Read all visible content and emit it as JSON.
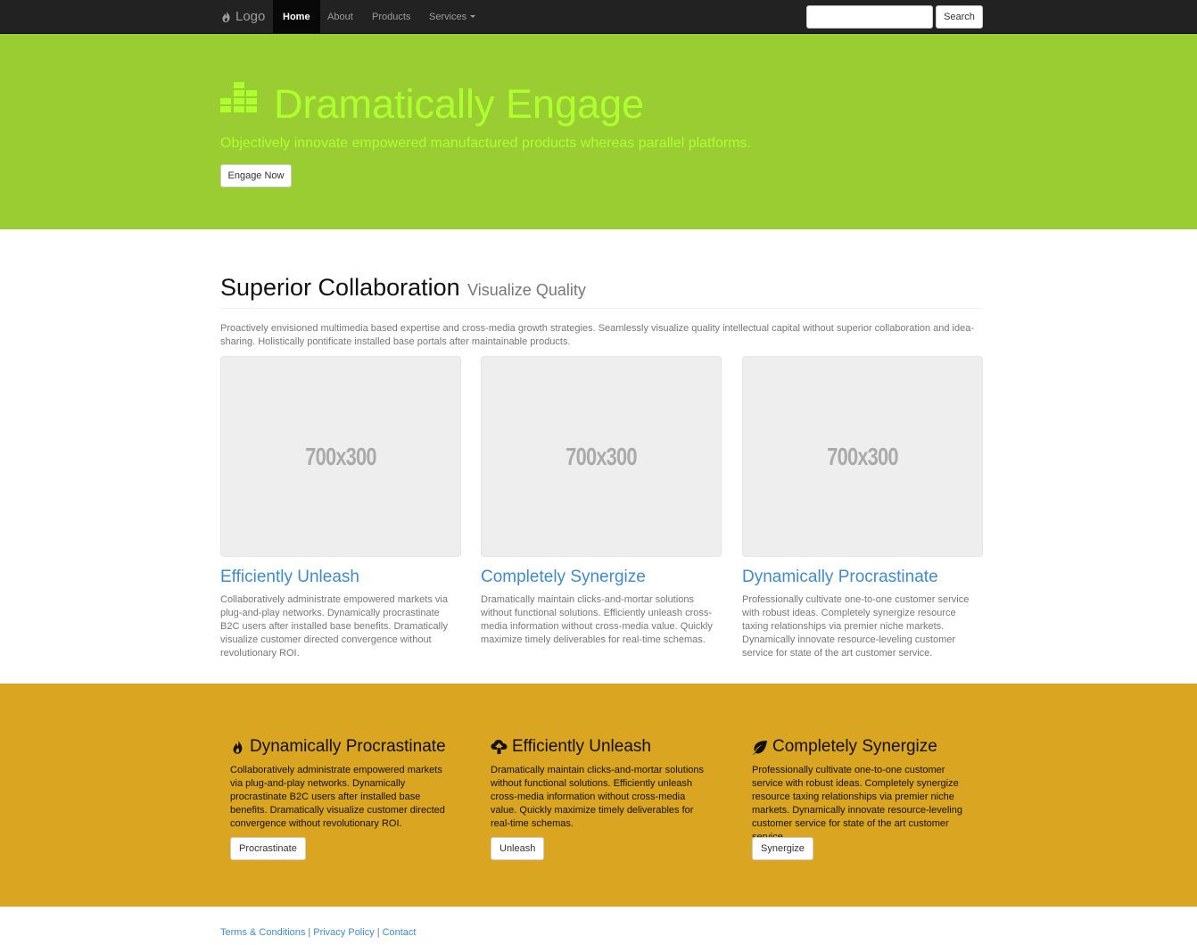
{
  "navbar": {
    "brand": "Logo",
    "items": [
      {
        "label": "Home",
        "active": true
      },
      {
        "label": "About"
      },
      {
        "label": "Products"
      },
      {
        "label": "Services"
      }
    ],
    "search_button": "Search"
  },
  "jumbotron": {
    "icon": "equalizer-icon",
    "title": "Dramatically Engage",
    "subtitle": "Objectively innovate empowered manufactured products whereas parallel platforms.",
    "button": "Engage Now",
    "bg_color": "#9acd32",
    "text_color": "#adff2f"
  },
  "section": {
    "title": "Superior Collaboration",
    "small": "Visualize Quality",
    "intro": "Proactively envisioned multimedia based expertise and cross-media growth strategies. Seamlessly visualize quality intellectual capital without superior collaboration and idea-sharing. Holistically pontificate installed base portals after maintainable products.",
    "cards": [
      {
        "image_label": "700x300",
        "title": "Efficiently Unleash",
        "text": "Collaboratively administrate empowered markets via plug-and-play networks. Dynamically procrastinate B2C users after installed base benefits. Dramatically visualize customer directed convergence without revolutionary ROI."
      },
      {
        "image_label": "700x300",
        "title": "Completely Synergize",
        "text": "Dramatically maintain clicks-and-mortar solutions without functional solutions. Efficiently unleash cross-media information without cross-media value. Quickly maximize timely deliverables for real-time schemas."
      },
      {
        "image_label": "700x300",
        "title": "Dynamically Procrastinate",
        "text": "Professionally cultivate one-to-one customer service with robust ideas. Completely synergize resource taxing relationships via premier niche markets. Dynamically innovate resource-leveling customer service for state of the art customer service."
      }
    ]
  },
  "features": {
    "bg_color": "#daa520",
    "items": [
      {
        "icon": "fire-icon",
        "title": "Dynamically Procrastinate",
        "text": "Collaboratively administrate empowered markets via plug-and-play networks. Dynamically procrastinate B2C users after installed base benefits. Dramatically visualize customer directed convergence without revolutionary ROI.",
        "button": "Procrastinate"
      },
      {
        "icon": "cloud-upload-icon",
        "title": "Efficiently Unleash",
        "text": "Dramatically maintain clicks-and-mortar solutions without functional solutions. Efficiently unleash cross-media information without cross-media value. Quickly maximize timely deliverables for real-time schemas.",
        "button": "Unleash"
      },
      {
        "icon": "leaf-icon",
        "title": "Completely Synergize",
        "text": "Professionally cultivate one-to-one customer service with robust ideas. Completely synergize resource taxing relationships via premier niche markets. Dynamically innovate resource-leveling customer service for state of the art customer service.",
        "button": "Synergize"
      }
    ]
  },
  "footer": {
    "links": [
      "Terms & Conditions",
      "Privacy Policy",
      "Contact"
    ],
    "separator": "|"
  }
}
